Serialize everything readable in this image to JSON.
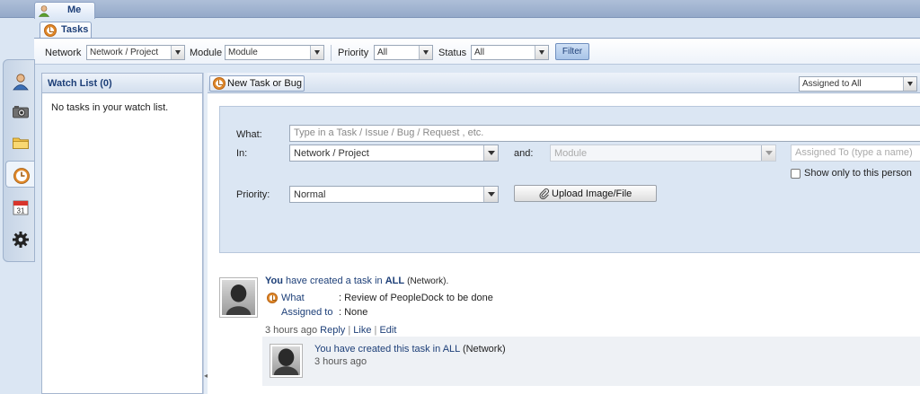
{
  "top_tabs": [
    {
      "label": "Me"
    }
  ],
  "sub_tabs": [
    {
      "label": "Tasks"
    }
  ],
  "filters": {
    "network_label": "Network",
    "network_value": "Network / Project",
    "module_label": "Module",
    "module_value": "Module",
    "priority_label": "Priority",
    "priority_value": "All",
    "status_label": "Status",
    "status_value": "All",
    "filter_button": "Filter"
  },
  "rail": [
    {
      "icon": "user-icon"
    },
    {
      "icon": "camera-icon"
    },
    {
      "icon": "folder-icon"
    },
    {
      "icon": "clock-icon",
      "active": true
    },
    {
      "icon": "calendar-icon",
      "day": "31"
    },
    {
      "icon": "gear-icon"
    }
  ],
  "watch_list": {
    "title": "Watch List (0)",
    "empty_text": "No tasks in your watch list."
  },
  "main": {
    "new_button": "New Task or Bug",
    "assigned_select": "Assigned to All"
  },
  "task_form": {
    "what_label": "What:",
    "what_placeholder": "Type in a Task / Issue / Bug / Request , etc.",
    "in_label": "In:",
    "in_value": "Network / Project",
    "and_label": "and:",
    "module_value": "Module",
    "assigned_placeholder": "Assigned To (type a name)",
    "show_only_label": "Show only to this person",
    "priority_label": "Priority:",
    "priority_value": "Normal",
    "upload_button": "Upload Image/File"
  },
  "feed": {
    "entry": {
      "actor": "You",
      "action": "have created a task in",
      "target": "ALL",
      "target_type": "(Network).",
      "what_label": "What",
      "what_value": ": Review of PeopleDock to be done",
      "assigned_label": "Assigned to",
      "assigned_value": ": None",
      "time": "3 hours ago",
      "reply": "Reply",
      "sep1": "|",
      "like": "Like",
      "sep2": "|",
      "edit": "Edit"
    },
    "reply": {
      "actor": "You",
      "action": "have created this task in",
      "target": "ALL",
      "target_type": "(Network)",
      "time": "3 hours ago"
    }
  }
}
